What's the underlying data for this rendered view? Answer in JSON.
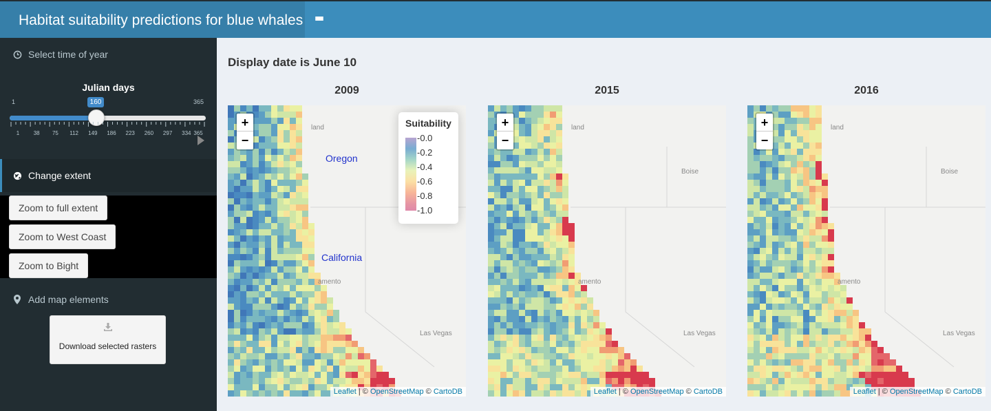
{
  "header": {
    "title": "Habitat suitability predictions for blue whales",
    "menu_icon": "hamburger-icon"
  },
  "sidebar": {
    "time_section": {
      "label": "Select time of year",
      "icon": "clock-icon"
    },
    "slider": {
      "label": "Julian days",
      "min": "1",
      "max": "365",
      "value": "160",
      "value_fraction": 0.436,
      "ticks": [
        "1",
        "38",
        "75",
        "112",
        "149",
        "186",
        "223",
        "260",
        "297",
        "334",
        "365"
      ]
    },
    "extent_section": {
      "label": "Change extent",
      "icon": "globe-icon"
    },
    "buttons": {
      "full_extent": "Zoom to full extent",
      "west_coast": "Zoom to West Coast",
      "bight": "Zoom to Bight"
    },
    "elements_section": {
      "label": "Add map elements",
      "icon": "map-marker-icon"
    },
    "download": {
      "label": "Download selected rasters",
      "icon": "download-icon"
    }
  },
  "main": {
    "display_date": "Display date is June 10",
    "maps": [
      {
        "title": "2009"
      },
      {
        "title": "2015"
      },
      {
        "title": "2016"
      }
    ],
    "zoom_in": "+",
    "zoom_out": "−",
    "places": {
      "oregon": "Oregon",
      "california": "California",
      "portland": "land",
      "boise": "Boise",
      "sacramento": "amento",
      "las_vegas": "Las Vegas"
    },
    "attribution": {
      "leaflet": "Leaflet",
      "osm": "OpenStreetMap",
      "cartodb": "CartoDB",
      "sep": " | © ",
      "copy": " © "
    },
    "legend": {
      "title": "Suitability",
      "labels": [
        "0.0",
        "0.2",
        "0.4",
        "0.6",
        "0.8",
        "1.0"
      ]
    }
  },
  "colors": {
    "header": "#3c8dbc",
    "brand": "#367fa9",
    "sidebar": "#222d32",
    "slider_accent": "#428bca",
    "content_bg": "#ecf0f5"
  }
}
